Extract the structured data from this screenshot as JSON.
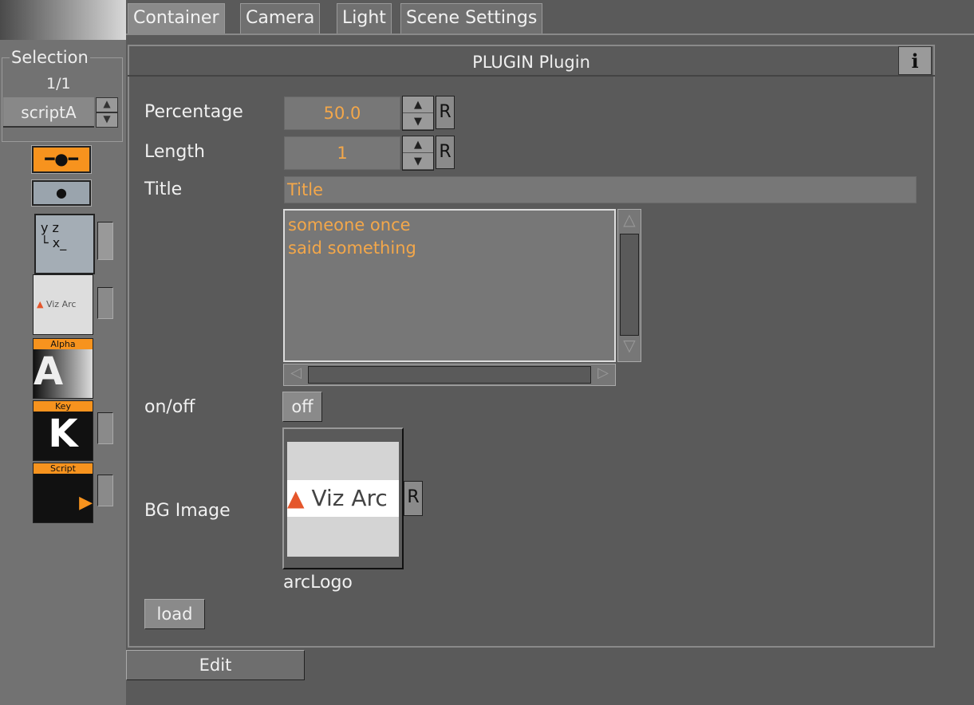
{
  "tabs": [
    {
      "label": "Container"
    },
    {
      "label": "Camera"
    },
    {
      "label": "Light"
    },
    {
      "label": "Scene Settings"
    }
  ],
  "selection": {
    "label": "Selection",
    "count": "1/1",
    "current": "scriptA"
  },
  "sidebar": {
    "thumbs": [
      {
        "label": "Viz Arc"
      },
      {
        "label": "Alpha"
      },
      {
        "label": "Key"
      },
      {
        "label": "Script"
      }
    ]
  },
  "plugin": {
    "title": "PLUGIN Plugin",
    "info_label": "i",
    "percentage": {
      "label": "Percentage",
      "value": "50.0",
      "reset": "R"
    },
    "length": {
      "label": "Length",
      "value": "1",
      "reset": "R"
    },
    "title_field": {
      "label": "Title",
      "value": "Title"
    },
    "text_area": {
      "value": "someone once\nsaid something"
    },
    "onoff": {
      "label": "on/off",
      "value": "off"
    },
    "bg_image": {
      "label": "BG Image",
      "image_text": "Viz Arc",
      "name": "arcLogo",
      "reset": "R"
    },
    "load_label": "load"
  },
  "edit_label": "Edit",
  "colors": {
    "accent": "#f3a74a",
    "orange": "#f7931e"
  }
}
